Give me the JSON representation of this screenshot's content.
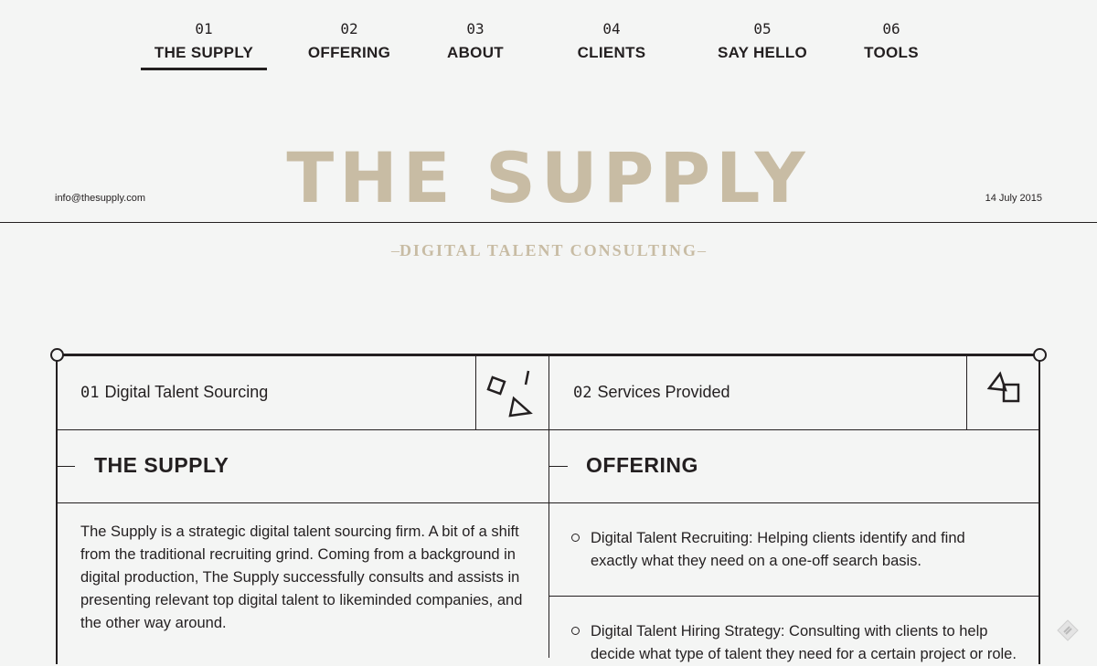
{
  "nav": [
    {
      "num": "01",
      "label": "THE SUPPLY"
    },
    {
      "num": "02",
      "label": "OFFERING"
    },
    {
      "num": "03",
      "label": "ABOUT"
    },
    {
      "num": "04",
      "label": "CLIENTS"
    },
    {
      "num": "05",
      "label": "SAY HELLO"
    },
    {
      "num": "06",
      "label": "TOOLS"
    }
  ],
  "header": {
    "logo": "THE SUPPLY",
    "email": "info@thesupply.com",
    "date": "14 July 2015",
    "tagline": "DIGITAL TALENT CONSULTING"
  },
  "cards": [
    {
      "num": "01",
      "title": "Digital Talent Sourcing",
      "section": "THE SUPPLY",
      "body": "The Supply is a strategic digital talent sourcing firm. A bit of a shift from the traditional recruiting grind. Coming from a background in digital production, The Supply successfully consults and assists in presenting relevant top digital talent to likeminded companies, and the other way around."
    },
    {
      "num": "02",
      "title": "Services Provided",
      "section": "OFFERING",
      "items": [
        "Digital Talent Recruiting: Helping clients identify and find exactly what they need on a one-off search basis.",
        "Digital Talent Hiring Strategy: Consulting with clients to help decide what type of talent they need for a certain project or role."
      ]
    }
  ],
  "colors": {
    "accent": "#c8bca4",
    "ink": "#231f20",
    "background": "#f4f5f4"
  }
}
